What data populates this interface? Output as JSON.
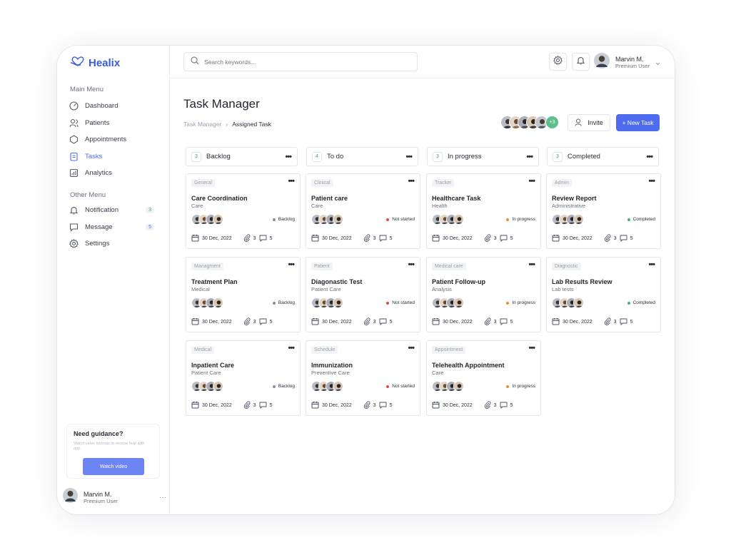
{
  "app": {
    "name": "Healix"
  },
  "sidebar": {
    "main_title": "Main Menu",
    "main_items": [
      {
        "label": "Dashboard",
        "icon": "dashboard-icon"
      },
      {
        "label": "Patients",
        "icon": "patients-icon"
      },
      {
        "label": "Appointments",
        "icon": "appointments-icon"
      },
      {
        "label": "Tasks",
        "icon": "tasks-icon",
        "active": true
      },
      {
        "label": "Analytics",
        "icon": "analytics-icon"
      }
    ],
    "other_title": "Other Menu",
    "other_items": [
      {
        "label": "Notification",
        "badge": "3"
      },
      {
        "label": "Message",
        "badge": "5"
      },
      {
        "label": "Settings"
      }
    ],
    "guide": {
      "title": "Need guidance?",
      "text": "Watch video tutorials to receive help with app.",
      "button": "Watch video"
    },
    "user": {
      "name": "Marvin M.",
      "role": "Premium User"
    }
  },
  "topbar": {
    "search_placeholder": "Search keywords...",
    "user": {
      "name": "Marvin M.",
      "role": "Premium User"
    }
  },
  "page": {
    "title": "Task Manager",
    "breadcrumb": {
      "parent": "Task Manager",
      "current": "Assigned Task"
    },
    "more_members": "+3",
    "invite_label": "Invite",
    "new_task_label": "+ New Task"
  },
  "columns": [
    {
      "count": "3",
      "title": "Backlog",
      "status_color": "#8a8e9b",
      "cards": [
        {
          "tag": "General",
          "title": "Care Coordination",
          "sub": "Care",
          "status": "Backlog",
          "date": "30 Dec, 2022",
          "attachments": "3",
          "comments": "5"
        },
        {
          "tag": "Managment",
          "title": "Treatment Plan",
          "sub": "Medical",
          "status": "Backlog",
          "date": "30 Dec, 2022",
          "attachments": "3",
          "comments": "5"
        },
        {
          "tag": "Medical",
          "title": "Inpatient Care",
          "sub": "Patient Care",
          "status": "Backlog",
          "date": "30 Dec, 2022",
          "attachments": "3",
          "comments": "5"
        }
      ]
    },
    {
      "count": "4",
      "title": "To do",
      "status_color": "#e5484d",
      "cards": [
        {
          "tag": "Clinical",
          "title": "Patient care",
          "sub": "Care",
          "status": "Not started",
          "date": "30 Dec, 2022",
          "attachments": "3",
          "comments": "5"
        },
        {
          "tag": "Patient",
          "title": "Diagonastic Test",
          "sub": "Patient Care",
          "status": "Not started",
          "date": "30 Dec, 2022",
          "attachments": "3",
          "comments": "5"
        },
        {
          "tag": "Schedule",
          "title": "Immunization",
          "sub": "Preventive Care",
          "status": "Not started",
          "date": "30 Dec, 2022",
          "attachments": "3",
          "comments": "5"
        }
      ]
    },
    {
      "count": "3",
      "title": "In progress",
      "status_color": "#f08c2c",
      "cards": [
        {
          "tag": "Tracker",
          "title": "Healthcare Task",
          "sub": "Health",
          "status": "In progress",
          "date": "30 Dec, 2022",
          "attachments": "3",
          "comments": "5"
        },
        {
          "tag": "Medical care",
          "title": "Patient Follow-up",
          "sub": "Analysis",
          "status": "In progress",
          "date": "30 Dec, 2022",
          "attachments": "3",
          "comments": "5"
        },
        {
          "tag": "Appointment",
          "title": "Telehealth Appointment",
          "sub": "Care",
          "status": "In progress",
          "date": "30 Dec, 2022",
          "attachments": "3",
          "comments": "5"
        }
      ]
    },
    {
      "count": "3",
      "title": "Completed",
      "status_color": "#3db87a",
      "cards": [
        {
          "tag": "Admin",
          "title": "Review Report",
          "sub": "Administrative",
          "status": "Completed",
          "date": "30 Dec, 2022",
          "attachments": "3",
          "comments": "5"
        },
        {
          "tag": "Diagnostic",
          "title": "Lab Results Review",
          "sub": "Lab tests",
          "status": "Completed",
          "date": "30 Dec, 2022",
          "attachments": "3",
          "comments": "5"
        }
      ]
    }
  ],
  "colors": {
    "accent": "#4f6cf0",
    "brand": "#3b5bdb"
  }
}
